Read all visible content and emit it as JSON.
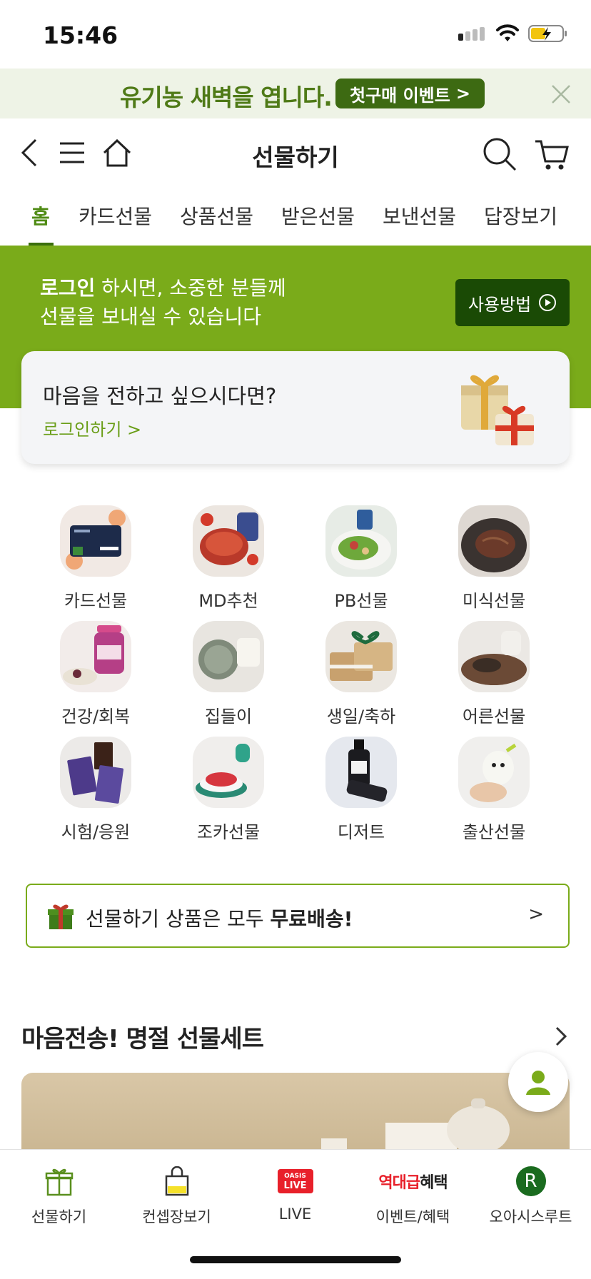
{
  "status_bar": {
    "time": "15:46"
  },
  "promo": {
    "text": "유기농 새벽을 엽니다.",
    "button_label": "첫구매 이벤트",
    "button_arrow": ">"
  },
  "header": {
    "title": "선물하기"
  },
  "tabs": [
    {
      "label": "홈",
      "active": true
    },
    {
      "label": "카드선물",
      "active": false
    },
    {
      "label": "상품선물",
      "active": false
    },
    {
      "label": "받은선물",
      "active": false
    },
    {
      "label": "보낸선물",
      "active": false
    },
    {
      "label": "답장보기",
      "active": false
    }
  ],
  "login_banner": {
    "bold": "로그인",
    "line1_rest": " 하시면, 소중한 분들께",
    "line2": "선물을 보내실 수 있습니다",
    "howto_label": "사용방법"
  },
  "login_card": {
    "title": "마음을 전하고 싶으시다면?",
    "link": "로그인하기 >"
  },
  "categories": [
    {
      "label": "카드선물",
      "icon": "gift-card-image"
    },
    {
      "label": "MD추천",
      "icon": "tomato-stew-image"
    },
    {
      "label": "PB선물",
      "icon": "salad-plate-image"
    },
    {
      "label": "미식선물",
      "icon": "steak-plate-image"
    },
    {
      "label": "건강/회복",
      "icon": "supplement-jar-image"
    },
    {
      "label": "집들이",
      "icon": "soap-bar-image"
    },
    {
      "label": "생일/축하",
      "icon": "gift-box-image"
    },
    {
      "label": "어른선물",
      "icon": "tea-bowl-image"
    },
    {
      "label": "시험/응원",
      "icon": "chocolate-bar-image"
    },
    {
      "label": "조카선물",
      "icon": "baby-bowl-image"
    },
    {
      "label": "디저트",
      "icon": "bottle-image"
    },
    {
      "label": "출산선물",
      "icon": "baby-toy-image"
    }
  ],
  "free_shipping": {
    "text": "선물하기 상품은 모두 ",
    "bold": "무료배송!",
    "arrow": ">"
  },
  "section": {
    "title": "마음전송! 명절 선물세트"
  },
  "bottom_nav": [
    {
      "label": "선물하기",
      "icon": "gift-icon"
    },
    {
      "label": "컨셉장보기",
      "icon": "shopping-bag-icon"
    },
    {
      "label": "LIVE",
      "icon": "oasis-live-icon",
      "badge_top": "OASIS",
      "badge_bottom": "LIVE"
    },
    {
      "label": "이벤트/혜택",
      "icon": "event-benefit-icon",
      "badge_red": "역대급",
      "badge_dark": "혜택"
    },
    {
      "label": "오아시스루트",
      "icon": "route-r-icon",
      "badge": "R"
    }
  ],
  "colors": {
    "brand_green": "#7aab1a",
    "dark_green": "#1a4a05",
    "promo_bg": "#eef3e6",
    "live_red": "#e8202a"
  }
}
